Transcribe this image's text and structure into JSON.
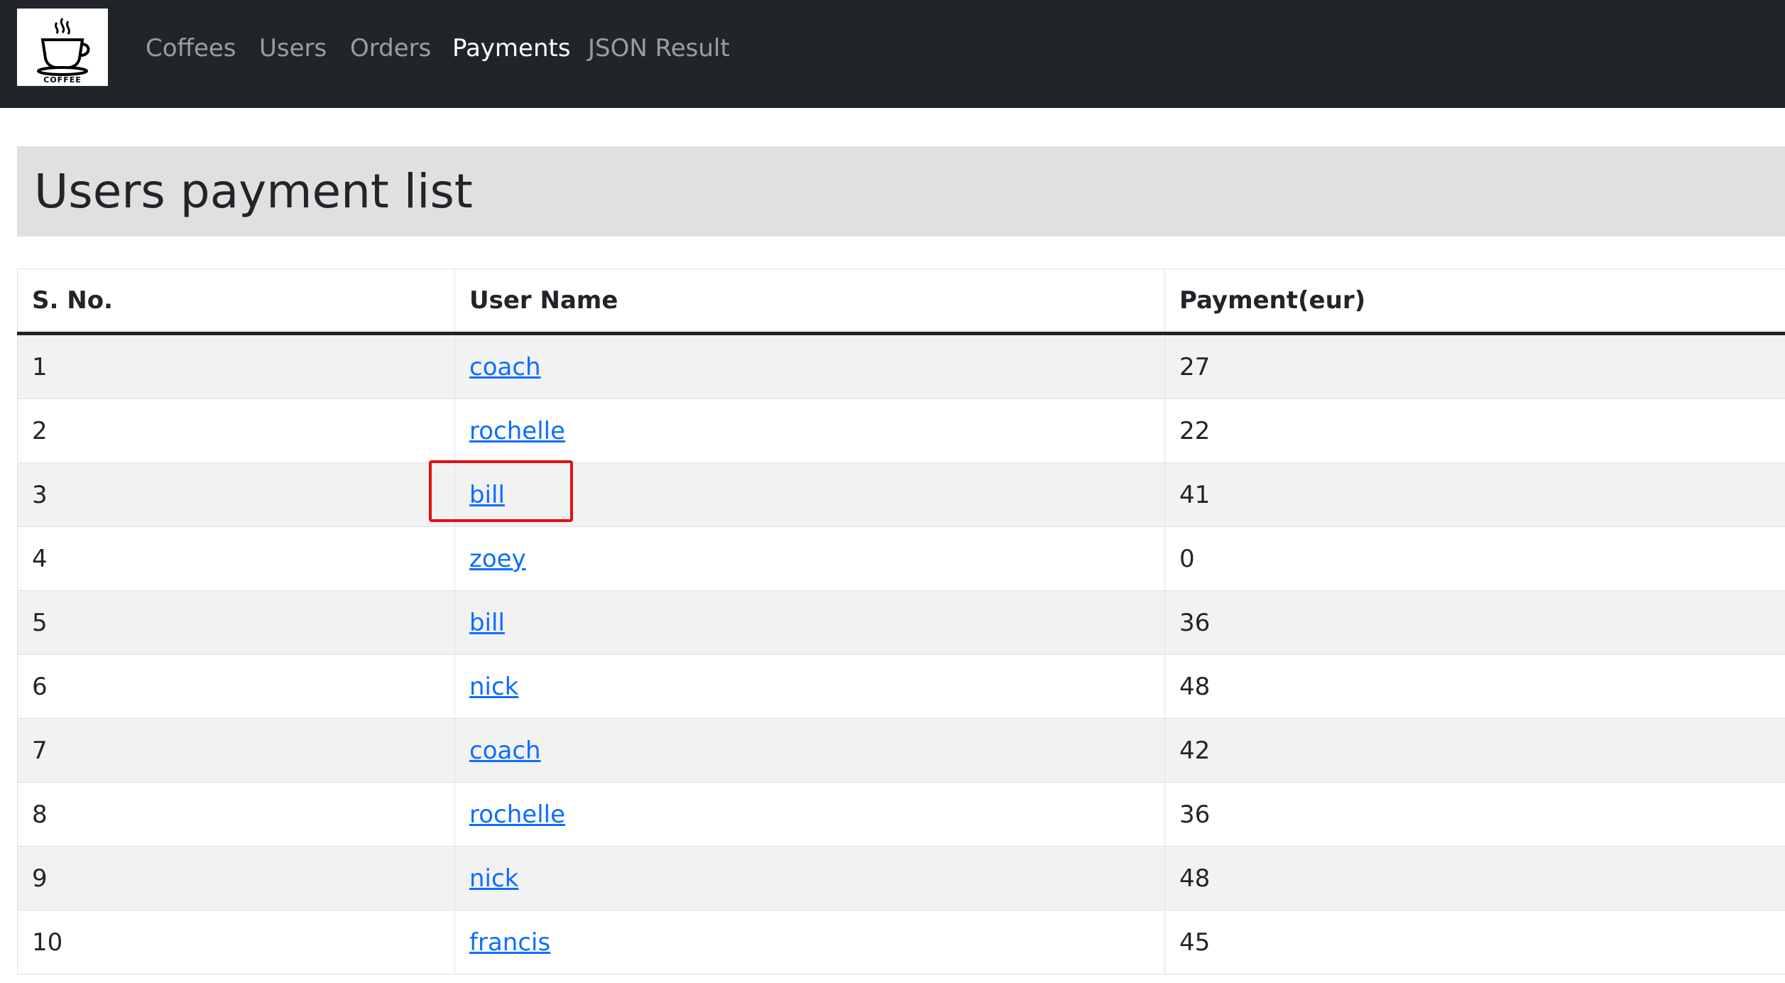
{
  "navbar": {
    "logo_text": "COFFEE",
    "links": [
      {
        "label": "Coffees",
        "active": false
      },
      {
        "label": "Users",
        "active": false
      },
      {
        "label": "Orders",
        "active": false
      },
      {
        "label": "Payments",
        "active": true
      },
      {
        "label": "JSON Result",
        "active": false
      }
    ]
  },
  "page": {
    "title": "Users payment list"
  },
  "table": {
    "headers": [
      "S. No.",
      "User Name",
      "Payment(eur)"
    ],
    "rows": [
      {
        "sno": "1",
        "user": "coach",
        "payment": "27"
      },
      {
        "sno": "2",
        "user": "rochelle",
        "payment": "22"
      },
      {
        "sno": "3",
        "user": "bill",
        "payment": "41"
      },
      {
        "sno": "4",
        "user": "zoey",
        "payment": "0"
      },
      {
        "sno": "5",
        "user": "bill",
        "payment": "36"
      },
      {
        "sno": "6",
        "user": "nick",
        "payment": "48"
      },
      {
        "sno": "7",
        "user": "coach",
        "payment": "42"
      },
      {
        "sno": "8",
        "user": "rochelle",
        "payment": "36"
      },
      {
        "sno": "9",
        "user": "nick",
        "payment": "48"
      },
      {
        "sno": "10",
        "user": "francis",
        "payment": "45"
      }
    ]
  },
  "colors": {
    "navbar_bg": "#212529",
    "link_blue": "#0d6efd",
    "highlight_red": "#e01010",
    "jumbotron_bg": "#e0e0e0"
  },
  "icons": {
    "logo": "coffee-cup-icon"
  }
}
